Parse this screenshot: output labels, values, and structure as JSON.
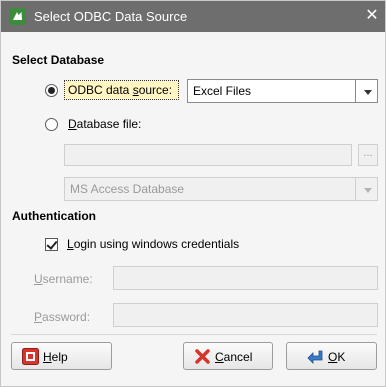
{
  "window": {
    "title": "Select ODBC Data Source",
    "close_glyph": "✕"
  },
  "select_database": {
    "heading": "Select Database",
    "odbc_option": {
      "prefix": "ODBC data ",
      "underlined": "s",
      "suffix": "ource:",
      "selected": true
    },
    "odbc_value": "Excel Files",
    "file_option": {
      "underlined": "D",
      "suffix": "atabase file:",
      "selected": false
    },
    "file_path_value": "",
    "browse_label": "...",
    "file_type_value": "MS Access Database"
  },
  "authentication": {
    "heading": "Authentication",
    "windows_login": {
      "underlined": "L",
      "suffix": "ogin using windows credentials",
      "checked": true
    },
    "username_label": {
      "underlined": "U",
      "suffix": "sername:"
    },
    "password_label": {
      "underlined": "P",
      "suffix": "assword:"
    },
    "username_value": "",
    "password_value": ""
  },
  "buttons": {
    "help": {
      "underlined": "H",
      "suffix": "elp"
    },
    "cancel": {
      "underlined": "C",
      "suffix": "ancel"
    },
    "ok": {
      "underlined": "O",
      "suffix": "K"
    }
  },
  "colors": {
    "titlebar": "#6e6e6e",
    "focus_highlight": "#fff6c4",
    "help_icon_red": "#d9342b",
    "ok_icon_blue": "#3a78c9"
  }
}
